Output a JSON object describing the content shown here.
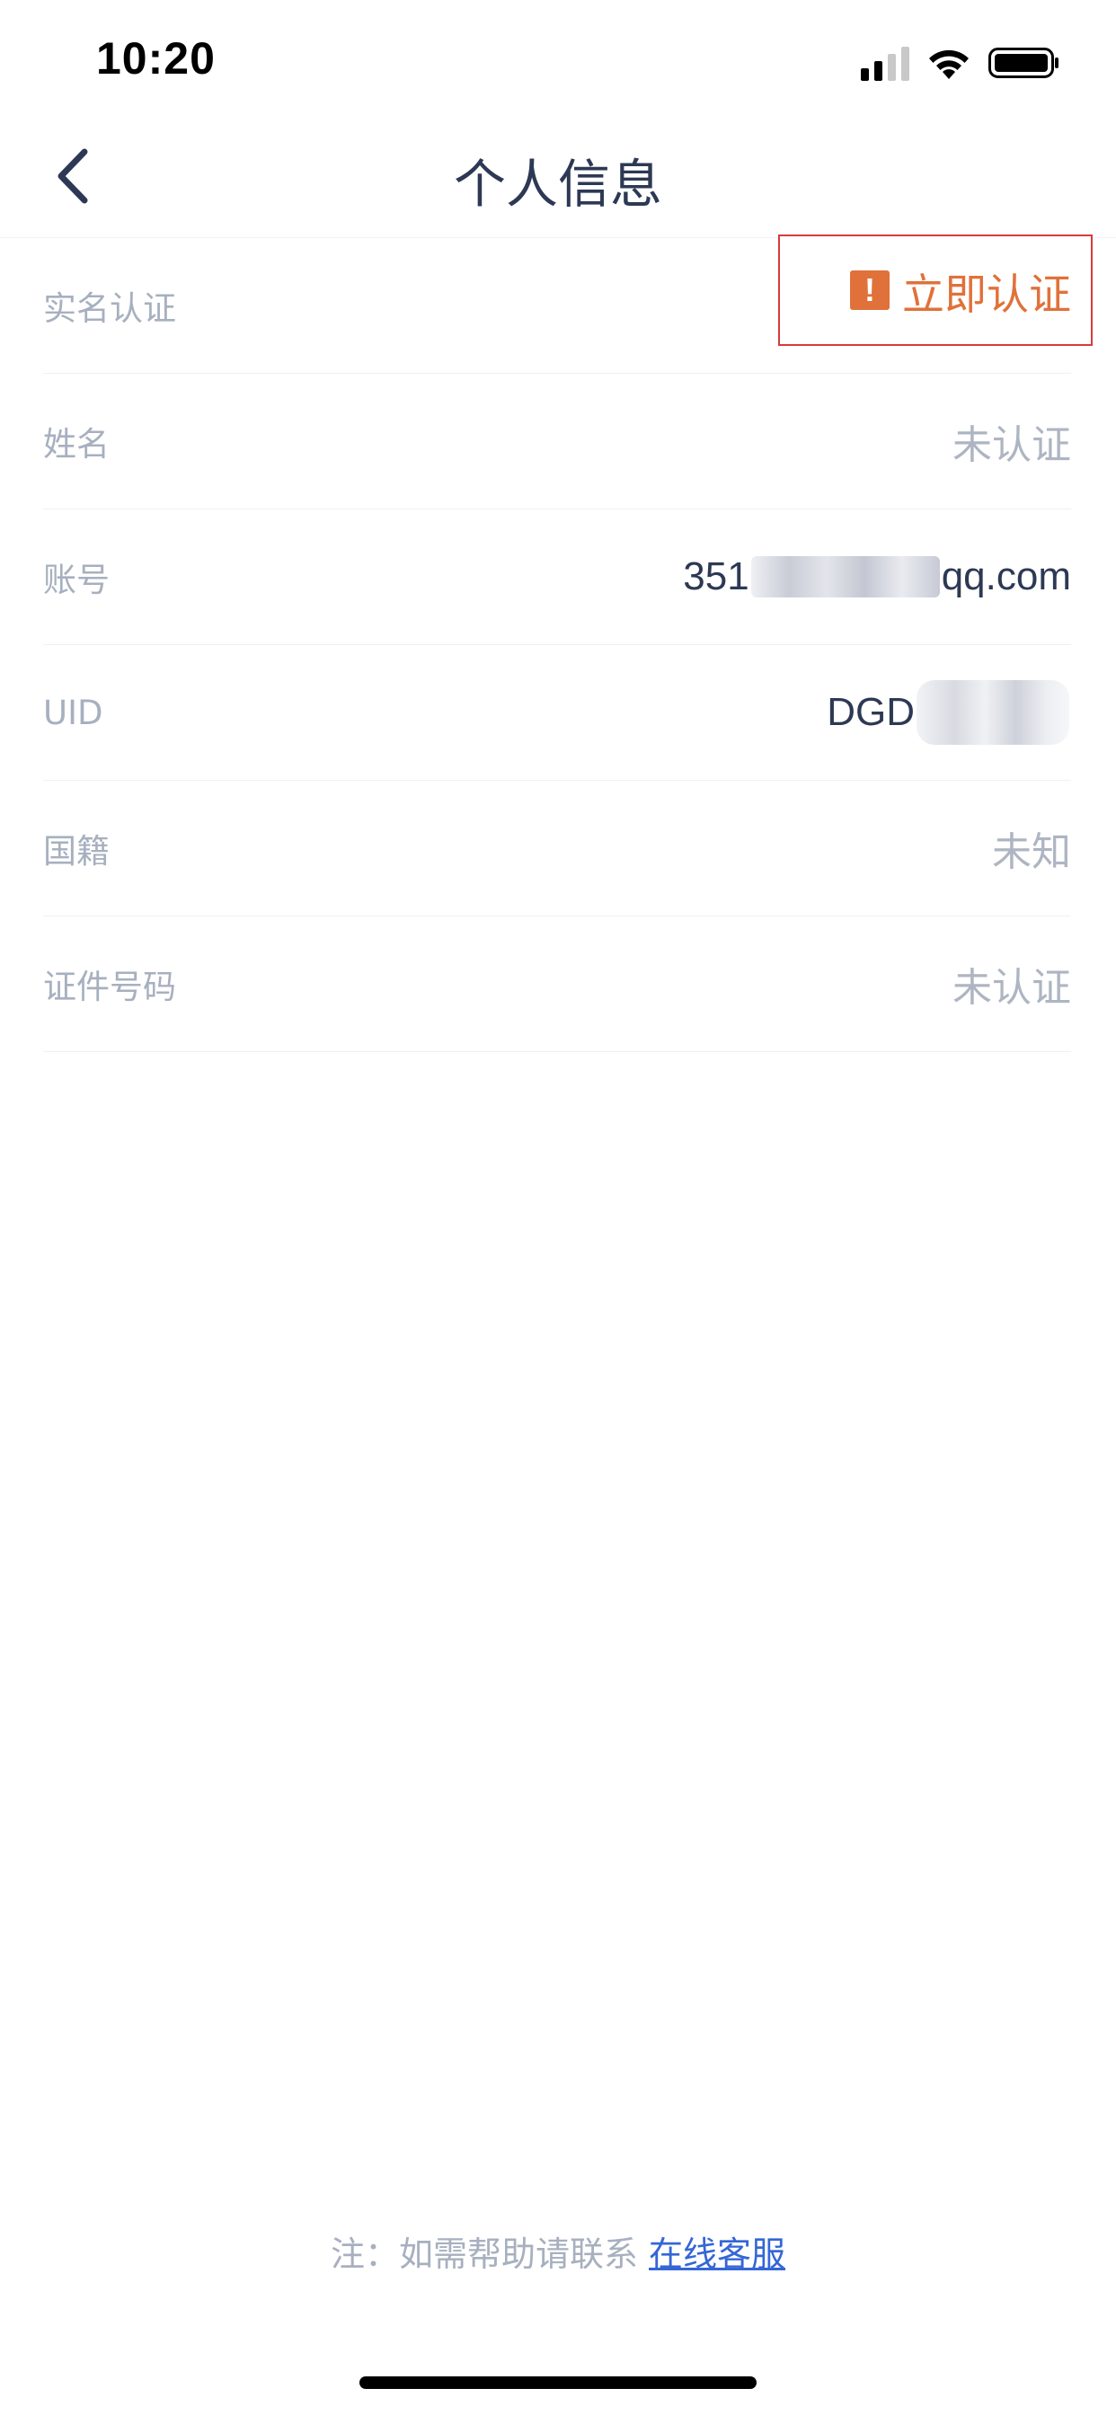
{
  "status_bar": {
    "time": "10:20"
  },
  "nav": {
    "title": "个人信息",
    "back_icon": "chevron-left-icon"
  },
  "rows": {
    "real_name_verification": {
      "label": "实名认证",
      "action_label": "立即认证",
      "action_icon": "warning-icon",
      "action_icon_glyph": "!"
    },
    "name": {
      "label": "姓名",
      "value": "未认证"
    },
    "account": {
      "label": "账号",
      "value_prefix": "351",
      "value_suffix": "qq.com"
    },
    "uid": {
      "label": "UID",
      "value_prefix": "DGD"
    },
    "nationality": {
      "label": "国籍",
      "value": "未知"
    },
    "id_number": {
      "label": "证件号码",
      "value": "未认证"
    }
  },
  "footer": {
    "note": "注：如需帮助请联系 ",
    "link": "在线客服"
  },
  "colors": {
    "title": "#2d3954",
    "label": "#a7b0bf",
    "accent_orange": "#e0713a",
    "highlight_border": "#d93a3a",
    "link": "#3466d6"
  }
}
